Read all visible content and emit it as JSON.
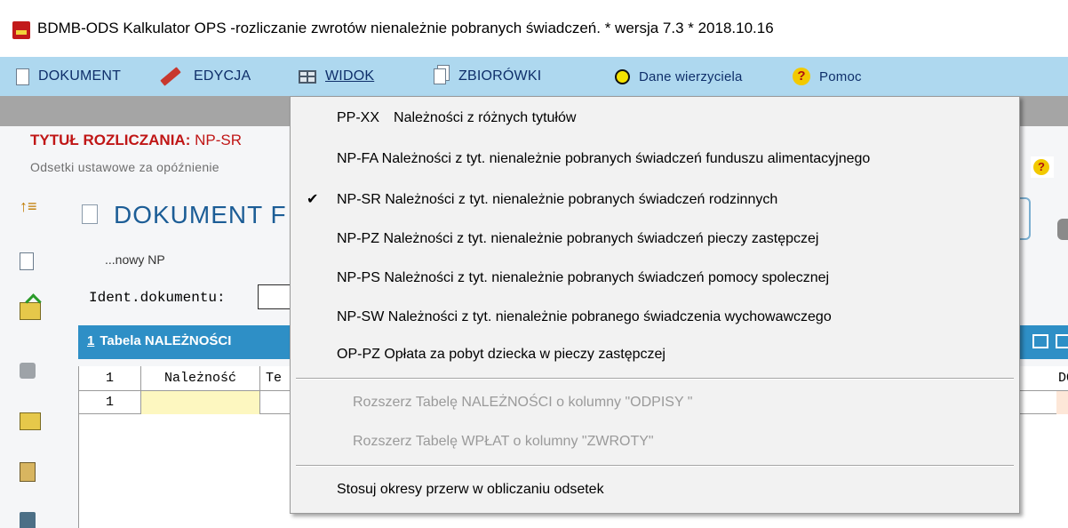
{
  "window": {
    "title": "BDMB-ODS Kalkulator OPS -rozliczanie zwrotów nienależnie pobranych świadczeń.  * wersja 7.3 * 2018.10.16"
  },
  "menubar": {
    "items": [
      {
        "label": "DOKUMENT",
        "icon": "document-icon"
      },
      {
        "label": "EDYCJA",
        "icon": "pencil-icon"
      },
      {
        "label": "WIDOK",
        "icon": "grid-icon"
      },
      {
        "label": "ZBIORÓWKI",
        "icon": "documents-icon"
      },
      {
        "label": "Dane wierzyciela",
        "icon": "yellow-circle-icon"
      },
      {
        "label": "Pomoc",
        "icon": "help-icon"
      }
    ]
  },
  "main": {
    "tytul_label": "TYTUŁ ROZLICZANIA:",
    "tytul_value": "NP-SR",
    "odsetki": "Odsetki ustawowe za opóźnienie",
    "doc_title": "DOKUMENT F",
    "nowy": "...nowy NP",
    "ident_label": "Ident.dokumentu:",
    "table_tab_number": "1",
    "table_tab_label": "Tabela NALEŻNOŚCI",
    "table_header": [
      "1",
      "Należność",
      "Te"
    ],
    "table_header_right": "DO za",
    "table_row": [
      "1",
      "",
      ""
    ]
  },
  "dropdown": {
    "items": [
      {
        "code": "PP-XX",
        "text": "Należności z różnych tytułów",
        "checked": false,
        "enabled": true
      },
      {
        "code": "",
        "text": "NP-FA Należności z tyt. nienależnie pobranych świadczeń funduszu alimentacyjnego",
        "checked": false,
        "enabled": true
      },
      {
        "code": "",
        "text": "NP-SR Należności z tyt. nienależnie pobranych świadczeń rodzinnych",
        "checked": true,
        "enabled": true
      },
      {
        "code": "",
        "text": "NP-PZ Należności z tyt. nienależnie pobranych świadczeń pieczy zastępczej",
        "checked": false,
        "enabled": true
      },
      {
        "code": "",
        "text": "NP-PS Należności z tyt. nienależnie pobranych świadczeń pomocy spolecznej",
        "checked": false,
        "enabled": true
      },
      {
        "code": "",
        "text": "NP-SW Należności z tyt. nienależnie pobranego świadczenia wychowawczego",
        "checked": false,
        "enabled": true
      },
      {
        "code": "",
        "text": "OP-PZ Opłata za pobyt dziecka w pieczy zastępczej",
        "checked": false,
        "enabled": true
      },
      {
        "code": "",
        "text": "Rozszerz  Tabelę NALEŻNOŚCI o  kolumny  \"ODPISY \"",
        "checked": false,
        "enabled": false
      },
      {
        "code": "",
        "text": "Rozszerz  Tabelę WPŁAT o kolumny \"ZWROTY\"",
        "checked": false,
        "enabled": false
      },
      {
        "code": "",
        "text": "Stosuj okresy przerw w obliczaniu odsetek",
        "checked": false,
        "enabled": true
      }
    ],
    "check_glyph": "✔"
  },
  "colors": {
    "menubar": "#aed8ef",
    "tab_bar": "#2e8fc6",
    "title_red": "#c01616",
    "doc_title_blue": "#1c5d96"
  }
}
